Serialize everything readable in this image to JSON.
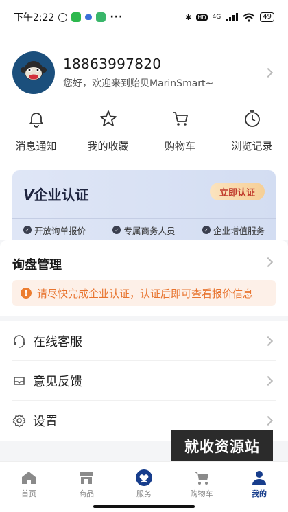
{
  "status_bar": {
    "time": "下午2:22",
    "network": "4G",
    "battery": "49"
  },
  "profile": {
    "phone": "18863997820",
    "welcome": "您好，欢迎来到贻贝MarinSmart~"
  },
  "quick_actions": [
    {
      "label": "消息通知",
      "icon": "bell-icon"
    },
    {
      "label": "我的收藏",
      "icon": "star-icon"
    },
    {
      "label": "购物车",
      "icon": "cart-icon"
    },
    {
      "label": "浏览记录",
      "icon": "clock-icon"
    }
  ],
  "certification": {
    "title": "企业认证",
    "button": "立即认证",
    "features": [
      "开放询单报价",
      "专属商务人员",
      "企业增值服务"
    ]
  },
  "inquiry": {
    "title": "询盘管理",
    "notice": "请尽快完成企业认证，认证后即可查看报价信息"
  },
  "menu": [
    {
      "label": "在线客服",
      "icon": "headset-icon"
    },
    {
      "label": "意见反馈",
      "icon": "feedback-icon"
    },
    {
      "label": "设置",
      "icon": "gear-icon"
    }
  ],
  "watermark": "就收资源站",
  "tabbar": [
    {
      "label": "首页",
      "icon": "home-icon",
      "active": false
    },
    {
      "label": "商品",
      "icon": "store-icon",
      "active": false
    },
    {
      "label": "服务",
      "icon": "service-icon",
      "active": false
    },
    {
      "label": "购物车",
      "icon": "cart-icon",
      "active": false
    },
    {
      "label": "我的",
      "icon": "user-icon",
      "active": true
    }
  ],
  "colors": {
    "brand": "#173d8c",
    "warning": "#e8742f",
    "cert_button": "#c0392b"
  }
}
